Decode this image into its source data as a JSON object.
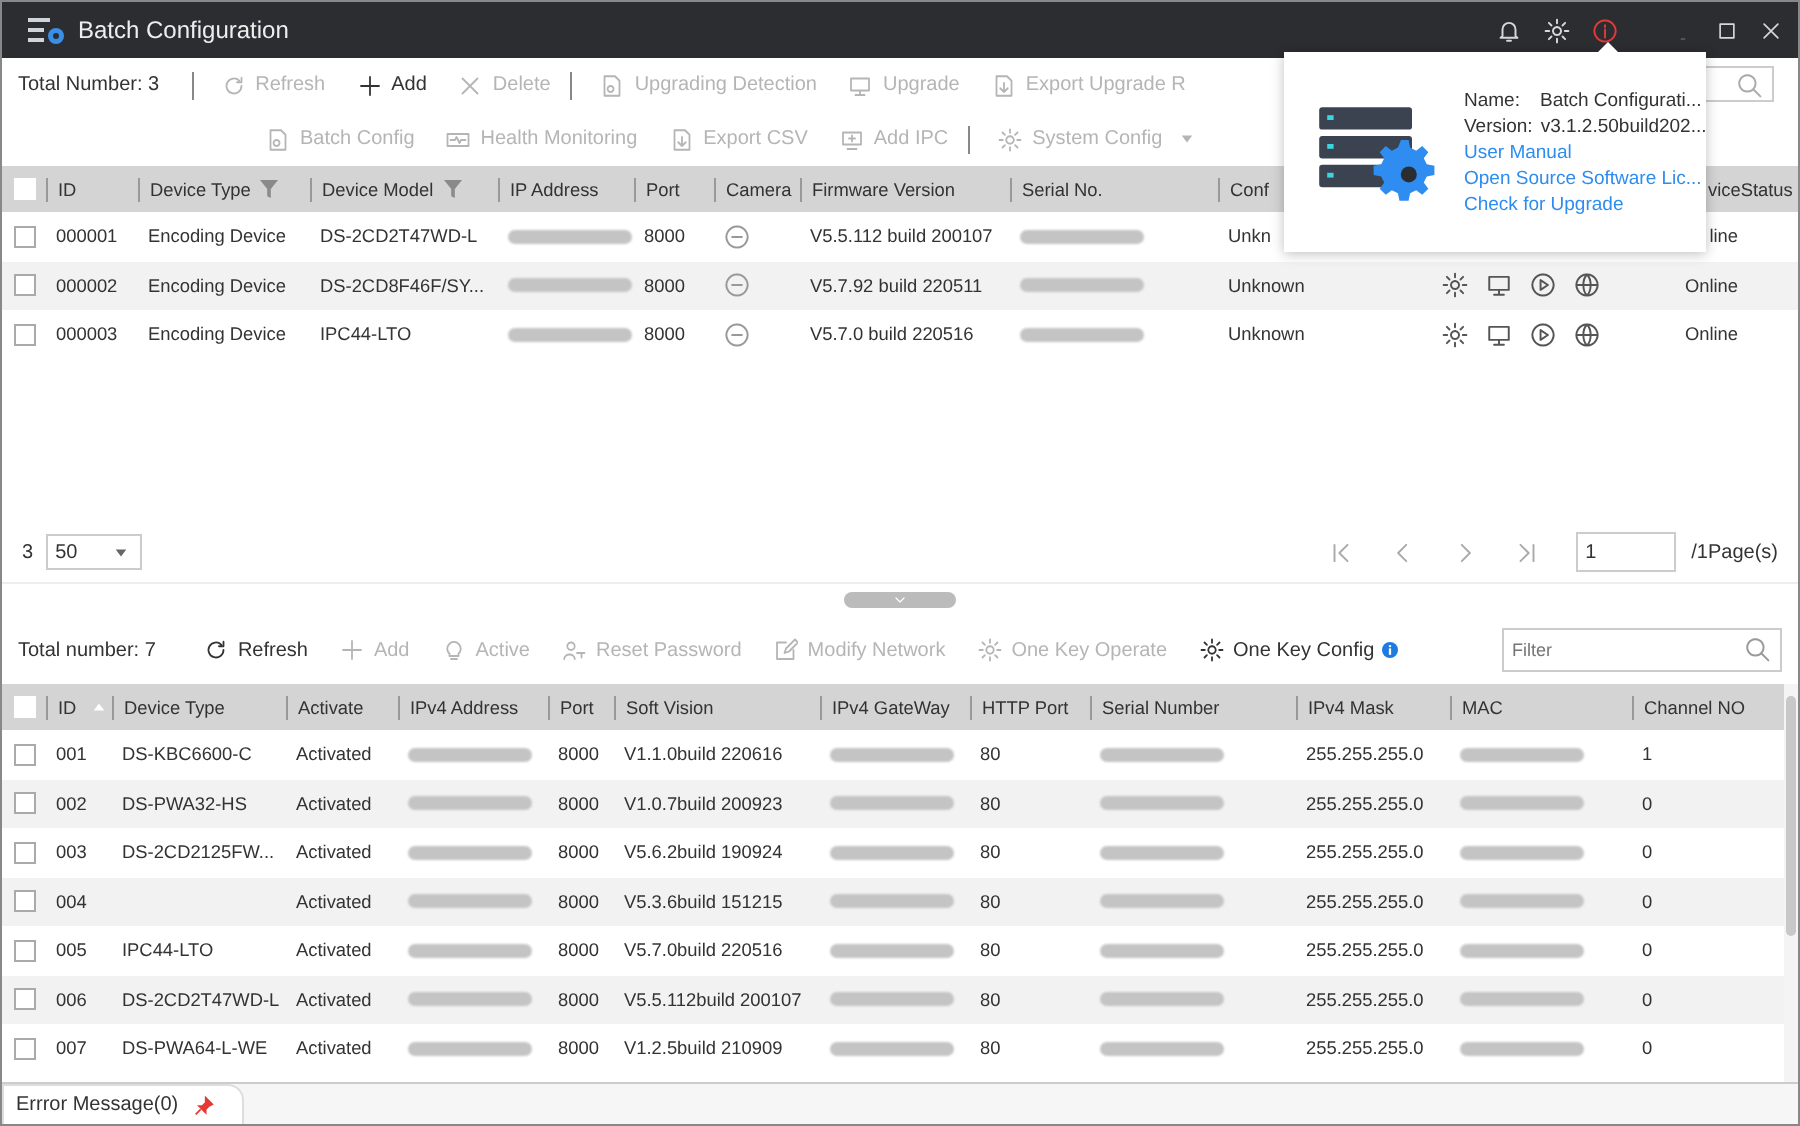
{
  "window": {
    "title": "Batch Configuration"
  },
  "top_toolbar": {
    "total": "Total Number: 3",
    "row1": [
      {
        "label": "Refresh",
        "disabled": true,
        "separator_before": true
      },
      {
        "label": "Add",
        "disabled": false,
        "separator_before": false
      },
      {
        "label": "Delete",
        "disabled": true,
        "separator_before": false
      },
      {
        "label": "Upgrading Detection",
        "disabled": true,
        "separator_before": true
      },
      {
        "label": "Upgrade",
        "disabled": true,
        "separator_before": false
      },
      {
        "label": "Export Upgrade R",
        "disabled": true,
        "separator_before": false
      }
    ],
    "row2": [
      {
        "label": "Batch Config",
        "disabled": true,
        "separator_before": false
      },
      {
        "label": "Health Monitoring",
        "disabled": true,
        "separator_before": false
      },
      {
        "label": "Export CSV",
        "disabled": true,
        "separator_before": false
      },
      {
        "label": "Add IPC",
        "disabled": true,
        "separator_before": false
      },
      {
        "label": "System Config",
        "disabled": true,
        "separator_before": true
      }
    ]
  },
  "device_table": {
    "all_checked": false,
    "columns": [
      {
        "label": "ID"
      },
      {
        "label": "Device Type",
        "filter": true
      },
      {
        "label": "Device Model",
        "filter": true
      },
      {
        "label": "IP Address"
      },
      {
        "label": "Port"
      },
      {
        "label": "Camera"
      },
      {
        "label": "Firmware Version"
      },
      {
        "label": "Serial No."
      },
      {
        "label": "Conf"
      },
      {},
      {
        "label": "viceStatus"
      }
    ],
    "rows": [
      {
        "checked": false,
        "cells": [
          "000001",
          "Encoding Device",
          "DS-2CD2T47WD-L",
          {
            "kind": "blur"
          },
          "8000",
          {
            "kind": "icon"
          },
          "V5.5.112 build 200107",
          {
            "kind": "blur"
          },
          "Unkn",
          {
            "kind": "empty"
          },
          "line"
        ]
      },
      {
        "checked": false,
        "cells": [
          "000002",
          "Encoding Device",
          "DS-2CD8F46F/SY...",
          {
            "kind": "blur"
          },
          "8000",
          {
            "kind": "icon"
          },
          "V5.7.92 build 220511",
          {
            "kind": "blur"
          },
          "Unknown",
          {
            "kind": "actions"
          },
          "Online"
        ]
      },
      {
        "checked": false,
        "cells": [
          "000003",
          "Encoding Device",
          "IPC44-LTO",
          {
            "kind": "blur"
          },
          "8000",
          {
            "kind": "icon"
          },
          "V5.7.0 build 220516",
          {
            "kind": "blur"
          },
          "Unknown",
          {
            "kind": "actions"
          },
          "Online"
        ]
      }
    ]
  },
  "pagination": {
    "count": "3",
    "page_size": "50",
    "page": "1",
    "pages": "/1Page(s)"
  },
  "online_toolbar": {
    "total": "Total number: 7",
    "buttons": [
      {
        "label": "Refresh",
        "disabled": false
      },
      {
        "label": "Add",
        "disabled": true
      },
      {
        "label": "Active",
        "disabled": true
      },
      {
        "label": "Reset Password",
        "disabled": true
      },
      {
        "label": "Modify Network",
        "disabled": true
      },
      {
        "label": "One Key Operate",
        "disabled": true
      },
      {
        "label": "One Key Config",
        "disabled": false
      }
    ],
    "filter": {
      "placeholder": "Filter"
    }
  },
  "online_table": {
    "all_checked": false,
    "columns": [
      "ID",
      "Device Type",
      "Activate",
      "IPv4 Address",
      "Port",
      "Soft Vision",
      "IPv4 GateWay",
      "HTTP Port",
      "Serial Number",
      "IPv4 Mask",
      "MAC",
      "Channel NO"
    ],
    "rows": [
      {
        "checked": false,
        "cells": [
          "001",
          "DS-KBC6600-C",
          "Activated",
          {
            "kind": "blur"
          },
          "8000",
          "V1.1.0build 220616",
          {
            "kind": "blur"
          },
          "80",
          {
            "kind": "blur"
          },
          "255.255.255.0",
          {
            "kind": "blur"
          },
          "1"
        ]
      },
      {
        "checked": false,
        "cells": [
          "002",
          "DS-PWA32-HS",
          "Activated",
          {
            "kind": "blur"
          },
          "8000",
          "V1.0.7build 200923",
          {
            "kind": "blur"
          },
          "80",
          {
            "kind": "blur"
          },
          "255.255.255.0",
          {
            "kind": "blur"
          },
          "0"
        ]
      },
      {
        "checked": false,
        "cells": [
          "003",
          "DS-2CD2125FW...",
          "Activated",
          {
            "kind": "blur"
          },
          "8000",
          "V5.6.2build 190924",
          {
            "kind": "blur"
          },
          "80",
          {
            "kind": "blur"
          },
          "255.255.255.0",
          {
            "kind": "blur"
          },
          "0"
        ]
      },
      {
        "checked": false,
        "cells": [
          "004",
          {
            "kind": "empty"
          },
          "Activated",
          {
            "kind": "blur"
          },
          "8000",
          "V5.3.6build 151215",
          {
            "kind": "blur"
          },
          "80",
          {
            "kind": "blur"
          },
          "255.255.255.0",
          {
            "kind": "blur"
          },
          "0"
        ]
      },
      {
        "checked": false,
        "cells": [
          "005",
          "IPC44-LTO",
          "Activated",
          {
            "kind": "blur"
          },
          "8000",
          "V5.7.0build 220516",
          {
            "kind": "blur"
          },
          "80",
          {
            "kind": "blur"
          },
          "255.255.255.0",
          {
            "kind": "blur"
          },
          "0"
        ]
      },
      {
        "checked": false,
        "cells": [
          "006",
          "DS-2CD2T47WD-L",
          "Activated",
          {
            "kind": "blur"
          },
          "8000",
          "V5.5.112build 200107",
          {
            "kind": "blur"
          },
          "80",
          {
            "kind": "blur"
          },
          "255.255.255.0",
          {
            "kind": "blur"
          },
          "0"
        ]
      },
      {
        "checked": false,
        "cells": [
          "007",
          "DS-PWA64-L-WE",
          "Activated",
          {
            "kind": "blur"
          },
          "8000",
          "V1.2.5build 210909",
          {
            "kind": "blur"
          },
          "80",
          {
            "kind": "blur"
          },
          "255.255.255.0",
          {
            "kind": "blur"
          },
          "0"
        ]
      }
    ]
  },
  "about_popup": {
    "name_label": "Name:",
    "name": "Batch Configurati...",
    "version_label": "Version:",
    "version": "v3.1.2.50build202...",
    "links": [
      "User Manual",
      "Open Source Software Lic...",
      "Check for Upgrade"
    ]
  },
  "bottom_tab": {
    "label": "Errror Message(0)"
  }
}
